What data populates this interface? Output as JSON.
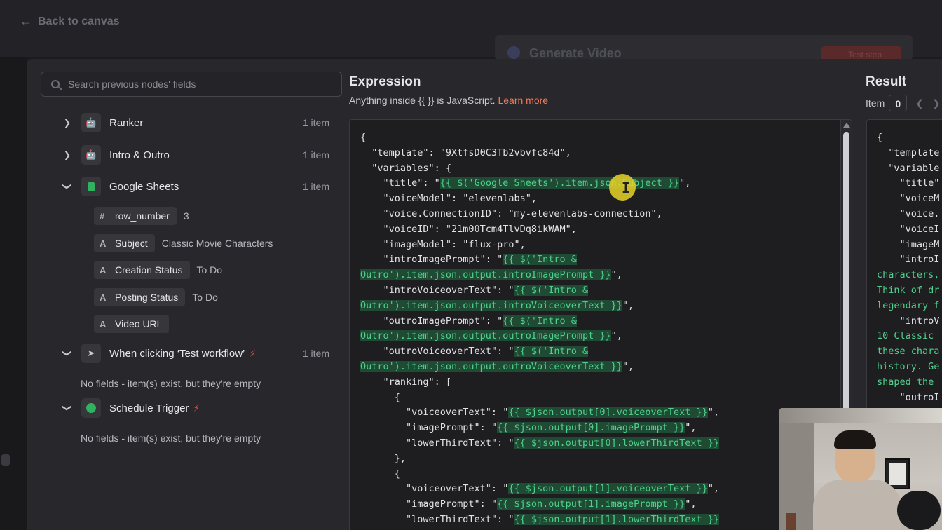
{
  "topbar": {
    "back_label": "Back to canvas",
    "background_node_title": "Generate Video",
    "background_button_label": "Test step"
  },
  "left_panel": {
    "search_placeholder": "Search previous nodes' fields",
    "nodes": [
      {
        "label": "Ranker",
        "count": "1 item",
        "expanded": false,
        "icon": "robot-icon"
      },
      {
        "label": "Intro & Outro",
        "count": "1 item",
        "expanded": false,
        "icon": "robot-icon"
      },
      {
        "label": "Google Sheets",
        "count": "1 item",
        "expanded": true,
        "icon": "sheets-icon"
      },
      {
        "label": "When clicking ‘Test workflow’",
        "count": "1 item",
        "expanded": true,
        "icon": "pointer-icon"
      },
      {
        "label": "Schedule Trigger",
        "expanded": true,
        "icon": "clock-icon"
      }
    ],
    "sheet_fields": [
      {
        "type": "#",
        "name": "row_number",
        "value": "3"
      },
      {
        "type": "A",
        "name": "Subject",
        "value": "Classic Movie Characters"
      },
      {
        "type": "A",
        "name": "Creation Status",
        "value": "To Do"
      },
      {
        "type": "A",
        "name": "Posting Status",
        "value": "To Do"
      },
      {
        "type": "A",
        "name": "Video URL",
        "value": ""
      }
    ],
    "empty_message_1": "No fields - item(s) exist, but they're empty",
    "empty_message_2": "No fields - item(s) exist, but they're empty"
  },
  "expression": {
    "title": "Expression",
    "subtitle": "Anything inside {{ }} is JavaScript.",
    "learn_more": "Learn more",
    "code_lines": [
      {
        "parts": [
          {
            "t": "{"
          }
        ]
      },
      {
        "parts": [
          {
            "t": "  \"template\": \"9XtfsD0C3Tb2vbvfc84d\","
          }
        ]
      },
      {
        "parts": [
          {
            "t": "  \"variables\": {"
          }
        ]
      },
      {
        "parts": [
          {
            "t": "    \"title\": \""
          },
          {
            "t": "{{ $('Google Sheets').item.json.Subject }}",
            "hl": true
          },
          {
            "t": "\","
          }
        ]
      },
      {
        "parts": [
          {
            "t": "    \"voiceModel\": \"elevenlabs\","
          }
        ]
      },
      {
        "parts": [
          {
            "t": "    \"voice.ConnectionID\": \"my-elevenlabs-connection\","
          }
        ]
      },
      {
        "parts": [
          {
            "t": "    \"voiceID\": \"21m00Tcm4TlvDq8ikWAM\","
          }
        ]
      },
      {
        "parts": [
          {
            "t": "    \"imageModel\": \"flux-pro\","
          }
        ]
      },
      {
        "parts": [
          {
            "t": "    \"introImagePrompt\": \""
          },
          {
            "t": "{{ $('Intro &",
            "hl": true
          }
        ]
      },
      {
        "parts": [
          {
            "t": "Outro').item.json.output.introImagePrompt }}",
            "hl": true
          },
          {
            "t": "\","
          }
        ]
      },
      {
        "parts": [
          {
            "t": "    \"introVoiceoverText\": \""
          },
          {
            "t": "{{ $('Intro &",
            "hl": true
          }
        ]
      },
      {
        "parts": [
          {
            "t": "Outro').item.json.output.introVoiceoverText }}",
            "hl": true
          },
          {
            "t": "\","
          }
        ]
      },
      {
        "parts": [
          {
            "t": "    \"outroImagePrompt\": \""
          },
          {
            "t": "{{ $('Intro &",
            "hl": true
          }
        ]
      },
      {
        "parts": [
          {
            "t": "Outro').item.json.output.outroImagePrompt }}",
            "hl": true
          },
          {
            "t": "\","
          }
        ]
      },
      {
        "parts": [
          {
            "t": "    \"outroVoiceoverText\": \""
          },
          {
            "t": "{{ $('Intro &",
            "hl": true
          }
        ]
      },
      {
        "parts": [
          {
            "t": "Outro').item.json.output.outroVoiceoverText }}",
            "hl": true
          },
          {
            "t": "\","
          }
        ]
      },
      {
        "parts": [
          {
            "t": "    \"ranking\": ["
          }
        ]
      },
      {
        "parts": [
          {
            "t": "      {"
          }
        ]
      },
      {
        "parts": [
          {
            "t": "        \"voiceoverText\": \""
          },
          {
            "t": "{{ $json.output[0].voiceoverText }}",
            "hl": true
          },
          {
            "t": "\","
          }
        ]
      },
      {
        "parts": [
          {
            "t": "        \"imagePrompt\": \""
          },
          {
            "t": "{{ $json.output[0].imagePrompt }}",
            "hl": true
          },
          {
            "t": "\","
          }
        ]
      },
      {
        "parts": [
          {
            "t": "        \"lowerThirdText\": \""
          },
          {
            "t": "{{ $json.output[0].lowerThirdText }}",
            "hl": true
          }
        ]
      },
      {
        "parts": [
          {
            "t": "      },"
          }
        ]
      },
      {
        "parts": [
          {
            "t": "      {"
          }
        ]
      },
      {
        "parts": [
          {
            "t": "        \"voiceoverText\": \""
          },
          {
            "t": "{{ $json.output[1].voiceoverText }}",
            "hl": true
          },
          {
            "t": "\","
          }
        ]
      },
      {
        "parts": [
          {
            "t": "        \"imagePrompt\": \""
          },
          {
            "t": "{{ $json.output[1].imagePrompt }}",
            "hl": true
          },
          {
            "t": "\","
          }
        ]
      },
      {
        "parts": [
          {
            "t": "        \"lowerThirdText\": \""
          },
          {
            "t": "{{ $json.output[1].lowerThirdText }}",
            "hl": true
          }
        ]
      }
    ]
  },
  "result": {
    "title": "Result",
    "item_label": "Item",
    "item_index": "0",
    "lines": [
      {
        "t": "{"
      },
      {
        "t": "  \"template"
      },
      {
        "t": "  \"variable"
      },
      {
        "t": "    \"title\""
      },
      {
        "t": "    \"voiceM"
      },
      {
        "t": "    \"voice."
      },
      {
        "t": "    \"voiceI"
      },
      {
        "t": "    \"imageM"
      },
      {
        "t": "    \"introI"
      },
      {
        "t": "characters,",
        "g": true
      },
      {
        "t": "Think of dr",
        "g": true
      },
      {
        "t": "legendary f",
        "g": true
      },
      {
        "t": "    \"introV"
      },
      {
        "t": "10 Classic",
        "g": true
      },
      {
        "t": "these chara",
        "g": true
      },
      {
        "t": "history. Ge",
        "g": true
      },
      {
        "t": "shaped the",
        "g": true
      },
      {
        "t": "    \"outroI"
      }
    ]
  },
  "colors": {
    "accent_link": "#f07a5a",
    "code_highlight_fg": "#4fd08b",
    "code_highlight_bg": "#1f4b35",
    "trigger_bolt": "#e0484a"
  }
}
